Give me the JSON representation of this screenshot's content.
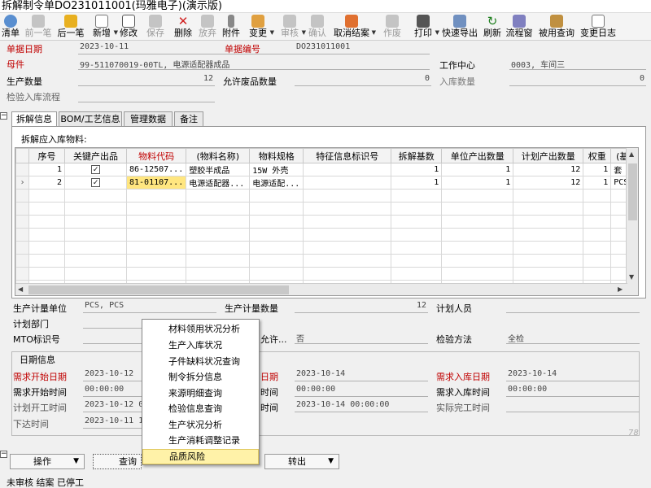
{
  "window": {
    "title": "拆解制令单DO231011001(玛雅电子)(演示版)"
  },
  "toolbar": {
    "list": "清单",
    "prev": "前一笔",
    "next": "后一笔",
    "new": "新增",
    "edit": "修改",
    "save": "保存",
    "delete": "删除",
    "discard": "放弃",
    "attach": "附件",
    "change": "变更",
    "audit": "审核",
    "confirm": "确认",
    "cancel_close": "取消结案",
    "void": "作废",
    "print": "打印",
    "export": "快速导出",
    "refresh": "刷新",
    "workflow": "流程窗",
    "used_query": "被用查询",
    "change_log": "变更日志"
  },
  "header": {
    "doc_date_label": "单据日期",
    "doc_date": "2023-10-11",
    "doc_no_label": "单据编号",
    "doc_no": "DO231011001",
    "parent_label": "母件",
    "parent": "99-511070019-00TL, 电源适配器成品",
    "work_center_label": "工作中心",
    "work_center": "0003, 车间三",
    "prod_qty_label": "生产数量",
    "prod_qty": "12",
    "scrap_qty_label": "允许废品数量",
    "scrap_qty": "0",
    "stockin_qty_label": "入库数量",
    "stockin_qty": "0",
    "inspect_flow_label": "检验入库流程"
  },
  "tabs": [
    "拆解信息",
    "BOM/工艺信息",
    "管理数据",
    "备注"
  ],
  "grid": {
    "caption": "拆解应入库物料:",
    "columns": [
      "序号",
      "关键产出品",
      "物料代码",
      "(物料名称)",
      "物料规格",
      "特征信息标识号",
      "拆解基数",
      "单位产出数量",
      "计划产出数量",
      "权重",
      "(基"
    ],
    "rows": [
      {
        "seq": "1",
        "key": "✓",
        "code": "86-12507...",
        "name": "塑胶半成品",
        "spec": "15W 外壳",
        "feature": "",
        "base": "1",
        "unit_out": "1",
        "plan_out": "12",
        "weight": "1",
        "basic": "套"
      },
      {
        "seq": "2",
        "key": "✓",
        "code": "81-01107...",
        "name": "电源适配器...",
        "spec": "电源适配...",
        "feature": "",
        "base": "1",
        "unit_out": "1",
        "plan_out": "12",
        "weight": "1",
        "basic": "PCS"
      }
    ]
  },
  "lower": {
    "plan_unit_label": "生产计量单位",
    "plan_unit": "PCS, PCS",
    "plan_qty_label": "生产计量数量",
    "plan_qty": "12",
    "planner_label": "计划人员",
    "plan_dept_label": "计划部门",
    "mto_label": "MTO标识号",
    "allow_label": "允许...",
    "allow": "否",
    "inspect_method_label": "检验方法",
    "inspect_method": "全检"
  },
  "dates": {
    "group_title": "日期信息",
    "req_start_date_label": "需求开始日期",
    "req_start_date": "2023-10-12",
    "req_start_time_label": "需求开始时间",
    "req_start_time": "00:00:00",
    "plan_start_label": "计划开工时间",
    "plan_start": "2023-10-12 00",
    "issue_label": "下达时间",
    "issue": "2023-10-11 14",
    "mid_date_label": "日期",
    "mid_date": "2023-10-14",
    "mid_time_label": "时间",
    "mid_time": "00:00:00",
    "mid_time2_label": "时间",
    "mid_time2": "2023-10-14 00:00:00",
    "req_in_date_label": "需求入库日期",
    "req_in_date": "2023-10-14",
    "req_in_time_label": "需求入库时间",
    "req_in_time": "00:00:00",
    "actual_finish_label": "实际完工时间"
  },
  "menu": [
    "材料领用状况分析",
    "生产入库状况",
    "子件缺料状况查询",
    "制令拆分信息",
    "来源明细查询",
    "检验信息查询",
    "生产状况分析",
    "生产消耗调整记录",
    "品质风险"
  ],
  "buttons": {
    "operate": "操作",
    "query": "查询",
    "transfer": "转出"
  },
  "status": "未审核 结案 已停工",
  "watermark": "78",
  "colors": {
    "required": "#c00000",
    "highlight": "#ffe680",
    "menu_hover": "#fff2a8"
  }
}
